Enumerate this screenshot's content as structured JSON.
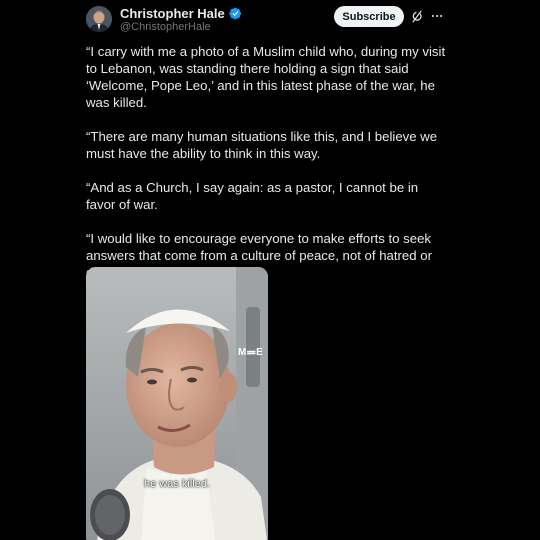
{
  "author": {
    "display_name": "Christopher Hale",
    "handle": "@ChristopherHale",
    "verified": true,
    "verified_color": "#1d9bf0"
  },
  "header": {
    "subscribe_label": "Subscribe",
    "grok_icon": "grok-icon",
    "more_icon": "more-icon"
  },
  "tweet": {
    "paragraphs": [
      "“I carry with me a photo of a Muslim child who, during my visit to Lebanon, was standing there holding a sign that said ‘Welcome, Pope Leo,’ and in this latest phase of the war, he was killed.",
      "“There are many human situations like this, and I believe we must have the ability to think in this way.",
      "“And as a Church, I say again: as a pastor, I cannot be in favor of war.",
      "“I would like to encourage everyone to make efforts to seek answers that come from a culture of peace, not of hatred or division.” — Pope Leo XIV"
    ]
  },
  "media": {
    "watermark": "M⩴E",
    "caption": "he was killed."
  },
  "colors": {
    "background": "#000000",
    "text": "#e7e9ea",
    "secondary_text": "#71767b",
    "button_bg": "#eff3f4"
  }
}
